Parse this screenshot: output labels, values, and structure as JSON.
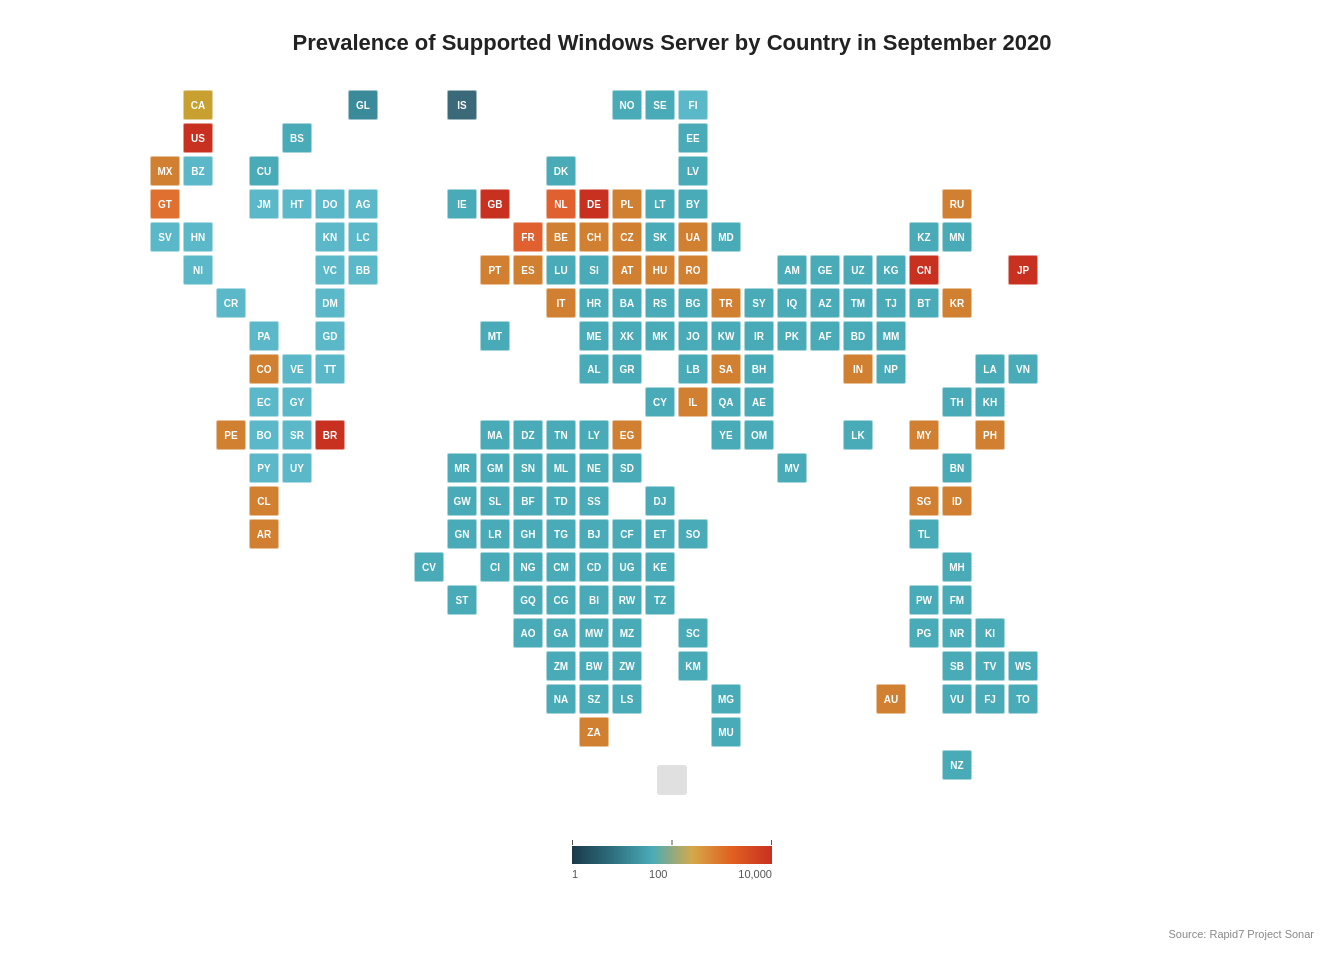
{
  "title": "Prevalence of Supported Windows Server by Country in September 2020",
  "source": "Source: Rapid7 Project Sonar",
  "legend": {
    "min": "1",
    "mid": "100",
    "max": "10,000"
  },
  "countries": [
    {
      "code": "CA",
      "col": 4,
      "row": 1,
      "color": "#c8a030"
    },
    {
      "code": "GL",
      "col": 9,
      "row": 1,
      "color": "#3a8a9a"
    },
    {
      "code": "IS",
      "col": 12,
      "row": 1,
      "color": "#3a6a7a"
    },
    {
      "code": "NO",
      "col": 17,
      "row": 1,
      "color": "#4aabb8"
    },
    {
      "code": "SE",
      "col": 18,
      "row": 1,
      "color": "#4aabb8"
    },
    {
      "code": "FI",
      "col": 19,
      "row": 1,
      "color": "#5ab8c8"
    },
    {
      "code": "US",
      "col": 4,
      "row": 2,
      "color": "#c83020"
    },
    {
      "code": "BS",
      "col": 7,
      "row": 2,
      "color": "#4aabb8"
    },
    {
      "code": "EE",
      "col": 19,
      "row": 2,
      "color": "#4aabb8"
    },
    {
      "code": "MX",
      "col": 3,
      "row": 3,
      "color": "#d08030"
    },
    {
      "code": "BZ",
      "col": 4,
      "row": 3,
      "color": "#5ab8c8"
    },
    {
      "code": "CU",
      "col": 6,
      "row": 3,
      "color": "#4aabb8"
    },
    {
      "code": "DK",
      "col": 15,
      "row": 3,
      "color": "#4aabb8"
    },
    {
      "code": "LV",
      "col": 19,
      "row": 3,
      "color": "#4aabb8"
    },
    {
      "code": "GT",
      "col": 3,
      "row": 4,
      "color": "#e07030"
    },
    {
      "code": "JM",
      "col": 6,
      "row": 4,
      "color": "#5ab8c8"
    },
    {
      "code": "HT",
      "col": 7,
      "row": 4,
      "color": "#5ab8c8"
    },
    {
      "code": "DO",
      "col": 8,
      "row": 4,
      "color": "#5ab8c8"
    },
    {
      "code": "AG",
      "col": 9,
      "row": 4,
      "color": "#5ab8c8"
    },
    {
      "code": "IE",
      "col": 12,
      "row": 4,
      "color": "#4aabb8"
    },
    {
      "code": "GB",
      "col": 13,
      "row": 4,
      "color": "#c83020"
    },
    {
      "code": "NL",
      "col": 15,
      "row": 4,
      "color": "#e06030"
    },
    {
      "code": "DE",
      "col": 16,
      "row": 4,
      "color": "#c83020"
    },
    {
      "code": "PL",
      "col": 17,
      "row": 4,
      "color": "#d08030"
    },
    {
      "code": "LT",
      "col": 18,
      "row": 4,
      "color": "#4aabb8"
    },
    {
      "code": "BY",
      "col": 19,
      "row": 4,
      "color": "#4aabb8"
    },
    {
      "code": "RU",
      "col": 27,
      "row": 4,
      "color": "#d08030"
    },
    {
      "code": "SV",
      "col": 3,
      "row": 5,
      "color": "#5ab8c8"
    },
    {
      "code": "HN",
      "col": 4,
      "row": 5,
      "color": "#5ab8c8"
    },
    {
      "code": "KN",
      "col": 8,
      "row": 5,
      "color": "#5ab8c8"
    },
    {
      "code": "LC",
      "col": 9,
      "row": 5,
      "color": "#5ab8c8"
    },
    {
      "code": "FR",
      "col": 14,
      "row": 5,
      "color": "#e06030"
    },
    {
      "code": "BE",
      "col": 15,
      "row": 5,
      "color": "#d08030"
    },
    {
      "code": "CH",
      "col": 16,
      "row": 5,
      "color": "#d08030"
    },
    {
      "code": "CZ",
      "col": 17,
      "row": 5,
      "color": "#d08030"
    },
    {
      "code": "SK",
      "col": 18,
      "row": 5,
      "color": "#4aabb8"
    },
    {
      "code": "UA",
      "col": 19,
      "row": 5,
      "color": "#d08030"
    },
    {
      "code": "MD",
      "col": 20,
      "row": 5,
      "color": "#4aabb8"
    },
    {
      "code": "KZ",
      "col": 26,
      "row": 5,
      "color": "#4aabb8"
    },
    {
      "code": "MN",
      "col": 27,
      "row": 5,
      "color": "#4aabb8"
    },
    {
      "code": "NI",
      "col": 4,
      "row": 6,
      "color": "#5ab8c8"
    },
    {
      "code": "VC",
      "col": 8,
      "row": 6,
      "color": "#5ab8c8"
    },
    {
      "code": "BB",
      "col": 9,
      "row": 6,
      "color": "#5ab8c8"
    },
    {
      "code": "PT",
      "col": 13,
      "row": 6,
      "color": "#d08030"
    },
    {
      "code": "ES",
      "col": 14,
      "row": 6,
      "color": "#d08030"
    },
    {
      "code": "LU",
      "col": 15,
      "row": 6,
      "color": "#4aabb8"
    },
    {
      "code": "SI",
      "col": 16,
      "row": 6,
      "color": "#4aabb8"
    },
    {
      "code": "AT",
      "col": 17,
      "row": 6,
      "color": "#d08030"
    },
    {
      "code": "HU",
      "col": 18,
      "row": 6,
      "color": "#d08030"
    },
    {
      "code": "RO",
      "col": 19,
      "row": 6,
      "color": "#d08030"
    },
    {
      "code": "AM",
      "col": 22,
      "row": 6,
      "color": "#4aabb8"
    },
    {
      "code": "GE",
      "col": 23,
      "row": 6,
      "color": "#4aabb8"
    },
    {
      "code": "UZ",
      "col": 24,
      "row": 6,
      "color": "#4aabb8"
    },
    {
      "code": "KG",
      "col": 25,
      "row": 6,
      "color": "#4aabb8"
    },
    {
      "code": "CN",
      "col": 26,
      "row": 6,
      "color": "#c83020"
    },
    {
      "code": "JP",
      "col": 29,
      "row": 6,
      "color": "#c83020"
    },
    {
      "code": "CR",
      "col": 5,
      "row": 7,
      "color": "#5ab8c8"
    },
    {
      "code": "DM",
      "col": 8,
      "row": 7,
      "color": "#5ab8c8"
    },
    {
      "code": "IT",
      "col": 15,
      "row": 7,
      "color": "#d08030"
    },
    {
      "code": "HR",
      "col": 16,
      "row": 7,
      "color": "#4aabb8"
    },
    {
      "code": "BA",
      "col": 17,
      "row": 7,
      "color": "#4aabb8"
    },
    {
      "code": "RS",
      "col": 18,
      "row": 7,
      "color": "#4aabb8"
    },
    {
      "code": "BG",
      "col": 19,
      "row": 7,
      "color": "#4aabb8"
    },
    {
      "code": "TR",
      "col": 20,
      "row": 7,
      "color": "#d08030"
    },
    {
      "code": "SY",
      "col": 21,
      "row": 7,
      "color": "#4aabb8"
    },
    {
      "code": "IQ",
      "col": 22,
      "row": 7,
      "color": "#4aabb8"
    },
    {
      "code": "AZ",
      "col": 23,
      "row": 7,
      "color": "#4aabb8"
    },
    {
      "code": "TM",
      "col": 24,
      "row": 7,
      "color": "#4aabb8"
    },
    {
      "code": "TJ",
      "col": 25,
      "row": 7,
      "color": "#4aabb8"
    },
    {
      "code": "BT",
      "col": 26,
      "row": 7,
      "color": "#4aabb8"
    },
    {
      "code": "KR",
      "col": 27,
      "row": 7,
      "color": "#d08030"
    },
    {
      "code": "PA",
      "col": 6,
      "row": 8,
      "color": "#5ab8c8"
    },
    {
      "code": "GD",
      "col": 8,
      "row": 8,
      "color": "#5ab8c8"
    },
    {
      "code": "MT",
      "col": 13,
      "row": 8,
      "color": "#4aabb8"
    },
    {
      "code": "ME",
      "col": 16,
      "row": 8,
      "color": "#4aabb8"
    },
    {
      "code": "XK",
      "col": 17,
      "row": 8,
      "color": "#4aabb8"
    },
    {
      "code": "MK",
      "col": 18,
      "row": 8,
      "color": "#4aabb8"
    },
    {
      "code": "JO",
      "col": 19,
      "row": 8,
      "color": "#4aabb8"
    },
    {
      "code": "KW",
      "col": 20,
      "row": 8,
      "color": "#4aabb8"
    },
    {
      "code": "IR",
      "col": 21,
      "row": 8,
      "color": "#4aabb8"
    },
    {
      "code": "PK",
      "col": 22,
      "row": 8,
      "color": "#4aabb8"
    },
    {
      "code": "AF",
      "col": 23,
      "row": 8,
      "color": "#4aabb8"
    },
    {
      "code": "BD",
      "col": 24,
      "row": 8,
      "color": "#4aabb8"
    },
    {
      "code": "MM",
      "col": 25,
      "row": 8,
      "color": "#4aabb8"
    },
    {
      "code": "CO",
      "col": 6,
      "row": 9,
      "color": "#d08030"
    },
    {
      "code": "VE",
      "col": 7,
      "row": 9,
      "color": "#5ab8c8"
    },
    {
      "code": "TT",
      "col": 8,
      "row": 9,
      "color": "#5ab8c8"
    },
    {
      "code": "AL",
      "col": 16,
      "row": 9,
      "color": "#4aabb8"
    },
    {
      "code": "GR",
      "col": 17,
      "row": 9,
      "color": "#4aabb8"
    },
    {
      "code": "LB",
      "col": 19,
      "row": 9,
      "color": "#4aabb8"
    },
    {
      "code": "SA",
      "col": 20,
      "row": 9,
      "color": "#d08030"
    },
    {
      "code": "BH",
      "col": 21,
      "row": 9,
      "color": "#4aabb8"
    },
    {
      "code": "IN",
      "col": 24,
      "row": 9,
      "color": "#d08030"
    },
    {
      "code": "NP",
      "col": 25,
      "row": 9,
      "color": "#4aabb8"
    },
    {
      "code": "LA",
      "col": 28,
      "row": 9,
      "color": "#4aabb8"
    },
    {
      "code": "VN",
      "col": 29,
      "row": 9,
      "color": "#4aabb8"
    },
    {
      "code": "EC",
      "col": 6,
      "row": 10,
      "color": "#5ab8c8"
    },
    {
      "code": "GY",
      "col": 7,
      "row": 10,
      "color": "#5ab8c8"
    },
    {
      "code": "CY",
      "col": 18,
      "row": 10,
      "color": "#4aabb8"
    },
    {
      "code": "IL",
      "col": 19,
      "row": 10,
      "color": "#d08030"
    },
    {
      "code": "QA",
      "col": 20,
      "row": 10,
      "color": "#4aabb8"
    },
    {
      "code": "AE",
      "col": 21,
      "row": 10,
      "color": "#4aabb8"
    },
    {
      "code": "TH",
      "col": 27,
      "row": 10,
      "color": "#4aabb8"
    },
    {
      "code": "KH",
      "col": 28,
      "row": 10,
      "color": "#4aabb8"
    },
    {
      "code": "PE",
      "col": 5,
      "row": 11,
      "color": "#d08030"
    },
    {
      "code": "BO",
      "col": 6,
      "row": 11,
      "color": "#5ab8c8"
    },
    {
      "code": "SR",
      "col": 7,
      "row": 11,
      "color": "#5ab8c8"
    },
    {
      "code": "BR",
      "col": 8,
      "row": 11,
      "color": "#c83020"
    },
    {
      "code": "MA",
      "col": 13,
      "row": 11,
      "color": "#4aabb8"
    },
    {
      "code": "DZ",
      "col": 14,
      "row": 11,
      "color": "#4aabb8"
    },
    {
      "code": "TN",
      "col": 15,
      "row": 11,
      "color": "#4aabb8"
    },
    {
      "code": "LY",
      "col": 16,
      "row": 11,
      "color": "#4aabb8"
    },
    {
      "code": "EG",
      "col": 17,
      "row": 11,
      "color": "#d08030"
    },
    {
      "code": "YE",
      "col": 20,
      "row": 11,
      "color": "#4aabb8"
    },
    {
      "code": "OM",
      "col": 21,
      "row": 11,
      "color": "#4aabb8"
    },
    {
      "code": "LK",
      "col": 24,
      "row": 11,
      "color": "#4aabb8"
    },
    {
      "code": "MY",
      "col": 26,
      "row": 11,
      "color": "#d08030"
    },
    {
      "code": "PH",
      "col": 28,
      "row": 11,
      "color": "#d08030"
    },
    {
      "code": "PY",
      "col": 6,
      "row": 12,
      "color": "#5ab8c8"
    },
    {
      "code": "UY",
      "col": 7,
      "row": 12,
      "color": "#5ab8c8"
    },
    {
      "code": "MR",
      "col": 12,
      "row": 12,
      "color": "#4aabb8"
    },
    {
      "code": "GM",
      "col": 13,
      "row": 12,
      "color": "#4aabb8"
    },
    {
      "code": "SN",
      "col": 14,
      "row": 12,
      "color": "#4aabb8"
    },
    {
      "code": "ML",
      "col": 15,
      "row": 12,
      "color": "#4aabb8"
    },
    {
      "code": "NE",
      "col": 16,
      "row": 12,
      "color": "#4aabb8"
    },
    {
      "code": "SD",
      "col": 17,
      "row": 12,
      "color": "#4aabb8"
    },
    {
      "code": "MV",
      "col": 22,
      "row": 12,
      "color": "#4aabb8"
    },
    {
      "code": "BN",
      "col": 27,
      "row": 12,
      "color": "#4aabb8"
    },
    {
      "code": "CL",
      "col": 6,
      "row": 13,
      "color": "#d08030"
    },
    {
      "code": "GW",
      "col": 12,
      "row": 13,
      "color": "#4aabb8"
    },
    {
      "code": "SL",
      "col": 13,
      "row": 13,
      "color": "#4aabb8"
    },
    {
      "code": "BF",
      "col": 14,
      "row": 13,
      "color": "#4aabb8"
    },
    {
      "code": "TD",
      "col": 15,
      "row": 13,
      "color": "#4aabb8"
    },
    {
      "code": "SS",
      "col": 16,
      "row": 13,
      "color": "#4aabb8"
    },
    {
      "code": "DJ",
      "col": 18,
      "row": 13,
      "color": "#4aabb8"
    },
    {
      "code": "SG",
      "col": 26,
      "row": 13,
      "color": "#d08030"
    },
    {
      "code": "ID",
      "col": 27,
      "row": 13,
      "color": "#d08030"
    },
    {
      "code": "AR",
      "col": 6,
      "row": 14,
      "color": "#d08030"
    },
    {
      "code": "GN",
      "col": 12,
      "row": 14,
      "color": "#4aabb8"
    },
    {
      "code": "LR",
      "col": 13,
      "row": 14,
      "color": "#4aabb8"
    },
    {
      "code": "GH",
      "col": 14,
      "row": 14,
      "color": "#4aabb8"
    },
    {
      "code": "TG",
      "col": 15,
      "row": 14,
      "color": "#4aabb8"
    },
    {
      "code": "BJ",
      "col": 16,
      "row": 14,
      "color": "#4aabb8"
    },
    {
      "code": "CF",
      "col": 17,
      "row": 14,
      "color": "#4aabb8"
    },
    {
      "code": "ET",
      "col": 18,
      "row": 14,
      "color": "#4aabb8"
    },
    {
      "code": "SO",
      "col": 19,
      "row": 14,
      "color": "#4aabb8"
    },
    {
      "code": "TL",
      "col": 26,
      "row": 14,
      "color": "#4aabb8"
    },
    {
      "code": "CV",
      "col": 11,
      "row": 15,
      "color": "#4aabb8"
    },
    {
      "code": "CI",
      "col": 13,
      "row": 15,
      "color": "#4aabb8"
    },
    {
      "code": "NG",
      "col": 14,
      "row": 15,
      "color": "#4aabb8"
    },
    {
      "code": "CM",
      "col": 15,
      "row": 15,
      "color": "#4aabb8"
    },
    {
      "code": "CD",
      "col": 16,
      "row": 15,
      "color": "#4aabb8"
    },
    {
      "code": "UG",
      "col": 17,
      "row": 15,
      "color": "#4aabb8"
    },
    {
      "code": "KE",
      "col": 18,
      "row": 15,
      "color": "#4aabb8"
    },
    {
      "code": "MH",
      "col": 27,
      "row": 15,
      "color": "#4aabb8"
    },
    {
      "code": "ST",
      "col": 12,
      "row": 16,
      "color": "#4aabb8"
    },
    {
      "code": "GQ",
      "col": 14,
      "row": 16,
      "color": "#4aabb8"
    },
    {
      "code": "CG",
      "col": 15,
      "row": 16,
      "color": "#4aabb8"
    },
    {
      "code": "BI",
      "col": 16,
      "row": 16,
      "color": "#4aabb8"
    },
    {
      "code": "RW",
      "col": 17,
      "row": 16,
      "color": "#4aabb8"
    },
    {
      "code": "TZ",
      "col": 18,
      "row": 16,
      "color": "#4aabb8"
    },
    {
      "code": "PW",
      "col": 26,
      "row": 16,
      "color": "#4aabb8"
    },
    {
      "code": "FM",
      "col": 27,
      "row": 16,
      "color": "#4aabb8"
    },
    {
      "code": "AO",
      "col": 14,
      "row": 17,
      "color": "#4aabb8"
    },
    {
      "code": "GA",
      "col": 15,
      "row": 17,
      "color": "#4aabb8"
    },
    {
      "code": "MW",
      "col": 16,
      "row": 17,
      "color": "#4aabb8"
    },
    {
      "code": "MZ",
      "col": 17,
      "row": 17,
      "color": "#4aabb8"
    },
    {
      "code": "SC",
      "col": 19,
      "row": 17,
      "color": "#4aabb8"
    },
    {
      "code": "PG",
      "col": 26,
      "row": 17,
      "color": "#4aabb8"
    },
    {
      "code": "NR",
      "col": 27,
      "row": 17,
      "color": "#4aabb8"
    },
    {
      "code": "KI",
      "col": 28,
      "row": 17,
      "color": "#4aabb8"
    },
    {
      "code": "ZM",
      "col": 15,
      "row": 18,
      "color": "#4aabb8"
    },
    {
      "code": "BW",
      "col": 16,
      "row": 18,
      "color": "#4aabb8"
    },
    {
      "code": "ZW",
      "col": 17,
      "row": 18,
      "color": "#4aabb8"
    },
    {
      "code": "KM",
      "col": 19,
      "row": 18,
      "color": "#4aabb8"
    },
    {
      "code": "SB",
      "col": 27,
      "row": 18,
      "color": "#4aabb8"
    },
    {
      "code": "TV",
      "col": 28,
      "row": 18,
      "color": "#4aabb8"
    },
    {
      "code": "WS",
      "col": 29,
      "row": 18,
      "color": "#4aabb8"
    },
    {
      "code": "NA",
      "col": 15,
      "row": 19,
      "color": "#4aabb8"
    },
    {
      "code": "SZ",
      "col": 16,
      "row": 19,
      "color": "#4aabb8"
    },
    {
      "code": "LS",
      "col": 17,
      "row": 19,
      "color": "#4aabb8"
    },
    {
      "code": "MG",
      "col": 20,
      "row": 19,
      "color": "#4aabb8"
    },
    {
      "code": "AU",
      "col": 25,
      "row": 19,
      "color": "#d08030"
    },
    {
      "code": "VU",
      "col": 27,
      "row": 19,
      "color": "#4aabb8"
    },
    {
      "code": "FJ",
      "col": 28,
      "row": 19,
      "color": "#4aabb8"
    },
    {
      "code": "TO",
      "col": 29,
      "row": 19,
      "color": "#4aabb8"
    },
    {
      "code": "ZA",
      "col": 16,
      "row": 20,
      "color": "#d08030"
    },
    {
      "code": "MU",
      "col": 20,
      "row": 20,
      "color": "#4aabb8"
    },
    {
      "code": "NZ",
      "col": 27,
      "row": 21,
      "color": "#4aabb8"
    }
  ]
}
